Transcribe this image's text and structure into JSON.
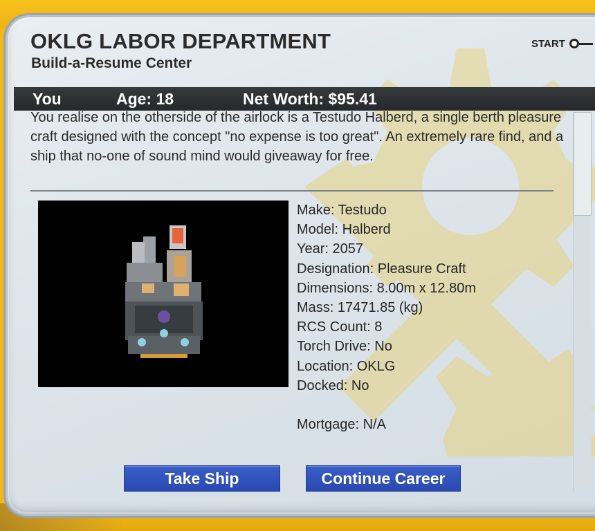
{
  "header": {
    "title": "OKLG LABOR DEPARTMENT",
    "subtitle": "Build-a-Resume Center",
    "start_label": "START"
  },
  "status": {
    "name": "You",
    "age": "Age: 18",
    "net_worth": "Net Worth: $95.41"
  },
  "description": "You realise on the otherside of the airlock is a Testudo Halberd, a single berth pleasure craft designed with the concept \"no expense is too great\". An extremely rare find, and a ship that no-one of sound mind would giveaway for free.",
  "ship": {
    "details": [
      "Make: Testudo",
      "Model: Halberd",
      "Year: 2057",
      "Designation: Pleasure Craft",
      "Dimensions: 8.00m x 12.80m",
      "Mass: 17471.85 (kg)",
      "RCS Count: 8",
      "Torch Drive: No",
      "Location: OKLG",
      "Docked: No",
      "",
      "Mortgage: N/A"
    ]
  },
  "buttons": {
    "take_ship": "Take Ship",
    "continue_career": "Continue Career"
  },
  "colors": {
    "accent": "#2a48b2",
    "background": "#f2b818",
    "status_bar": "#2b2f31"
  }
}
